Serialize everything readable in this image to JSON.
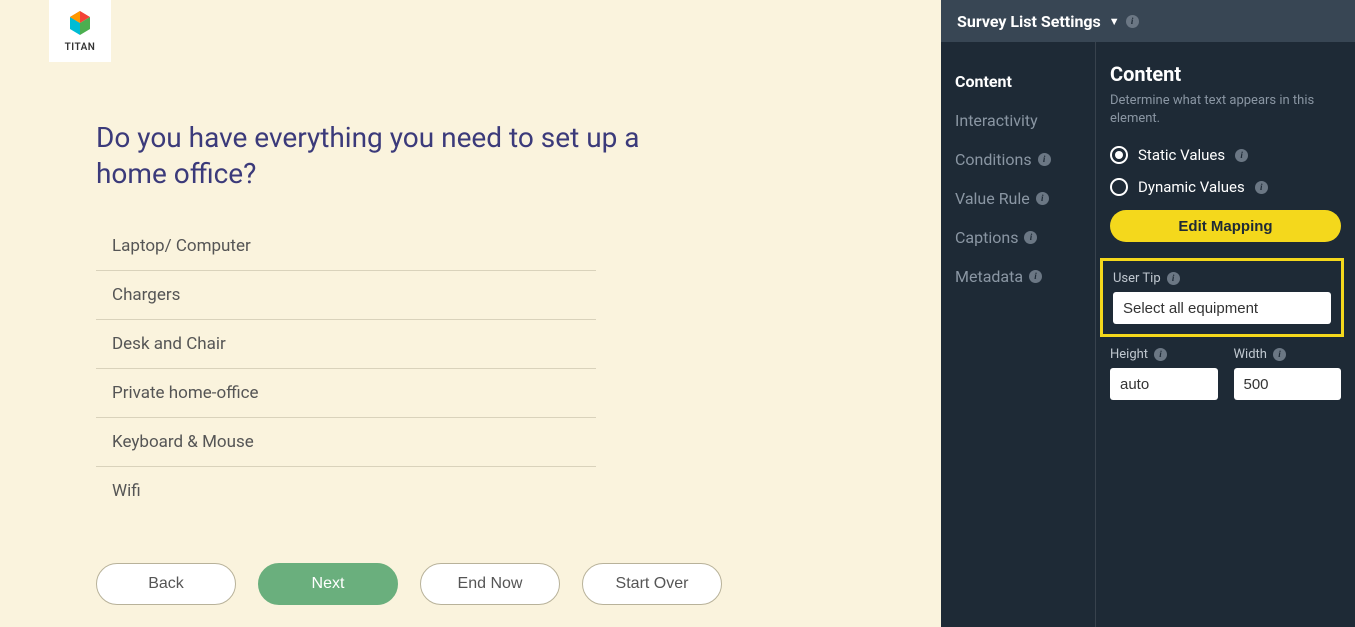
{
  "logo": {
    "text": "TITAN"
  },
  "survey": {
    "question": "Do you have everything you need to set up a home office?",
    "options": [
      "Laptop/ Computer",
      "Chargers",
      "Desk and Chair",
      "Private home-office",
      "Keyboard & Mouse",
      "Wifi"
    ],
    "nav": {
      "back": "Back",
      "next": "Next",
      "end_now": "End Now",
      "start_over": "Start Over"
    }
  },
  "sidebar": {
    "header_title": "Survey List Settings",
    "nav_items": [
      "Content",
      "Interactivity",
      "Conditions",
      "Value Rule",
      "Captions",
      "Metadata"
    ],
    "panel": {
      "title": "Content",
      "subtitle": "Determine what text appears in this element.",
      "static_values": "Static Values",
      "dynamic_values": "Dynamic Values",
      "edit_mapping": "Edit Mapping",
      "user_tip_label": "User Tip",
      "user_tip_value": "Select all equipment",
      "height_label": "Height",
      "height_value": "auto",
      "width_label": "Width",
      "width_value": "500"
    }
  }
}
